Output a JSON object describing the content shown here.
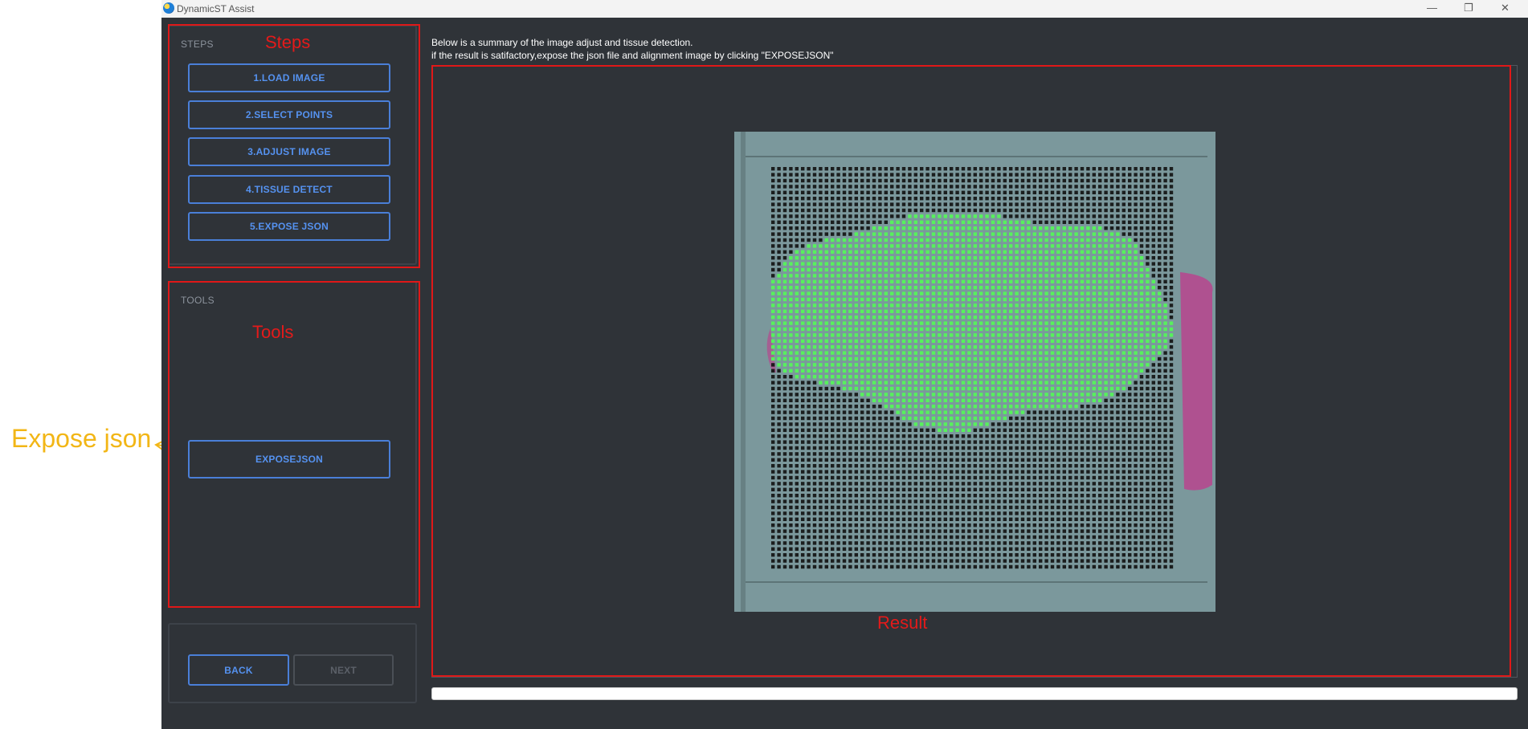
{
  "annotation": {
    "outer_label": "Expose json",
    "label_color": "#f2b616",
    "box_color": "#e01818"
  },
  "window": {
    "title": "DynamicST Assist",
    "controls": [
      "minimize",
      "restore",
      "close"
    ]
  },
  "steps": {
    "caption": "STEPS",
    "annotation": "Steps",
    "buttons": [
      "1.LOAD IMAGE",
      "2.SELECT POINTS",
      "3.ADJUST IMAGE",
      "4.TISSUE DETECT",
      "5.EXPOSE JSON"
    ]
  },
  "tools": {
    "caption": "TOOLS",
    "annotation": "Tools",
    "expose_button": "EXPOSEJSON"
  },
  "nav": {
    "back": "BACK",
    "next": "NEXT",
    "next_enabled": false
  },
  "info": {
    "line1": "Below is a summary of the image adjust and tissue detection.",
    "line2": "if the result is satifactory,expose the json file and alignment image by clicking \"EXPOSEJSON\""
  },
  "result": {
    "annotation": "Result",
    "spot_color": "#111111",
    "tissue_spot_color": "#55f55a",
    "tissue_edge_color": "#c03a8c"
  },
  "progress": {
    "value": 0
  },
  "colors": {
    "background": "#2f3338",
    "accent": "#4a7fd8"
  }
}
